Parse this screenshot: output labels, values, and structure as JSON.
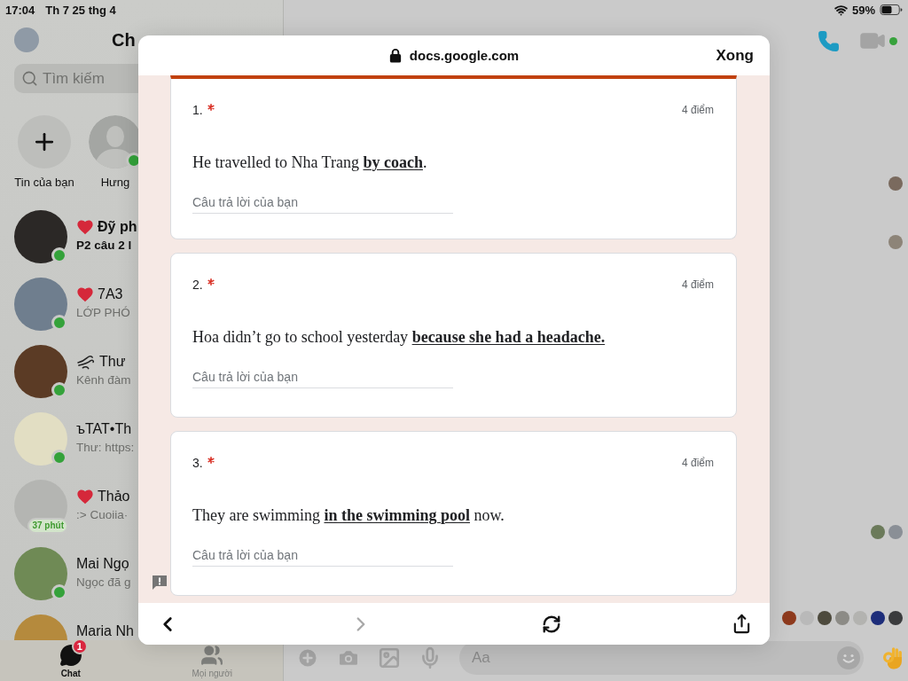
{
  "status_bar": {
    "time": "17:04",
    "date": "Th 7 25 thg 4",
    "battery": "59%"
  },
  "sidebar": {
    "title": "Ch",
    "search": {
      "placeholder": "Tìm kiếm"
    },
    "stories": [
      {
        "kind": "add",
        "label": "Tin của bạn"
      },
      {
        "kind": "person",
        "label": "Hưng",
        "online": true
      }
    ],
    "chats": [
      {
        "kind": "heart",
        "name": "Đỹ ph",
        "preview": "P2 câu 2 l",
        "unread": true,
        "online": true
      },
      {
        "kind": "heart",
        "name": "7A3",
        "preview": "LỚP PHÓ",
        "unread": false,
        "online": true
      },
      {
        "kind": "swirl",
        "name": "Thư",
        "preview": "Kênh đàm",
        "unread": false,
        "online": true
      },
      {
        "kind": "plain",
        "name": "ъTAT•Th",
        "preview": "Thư: https:",
        "unread": false,
        "online": true
      },
      {
        "kind": "heart",
        "name": "Thảo",
        "preview": ":> Cuoiia·",
        "unread": false,
        "online": false,
        "active_time": "37 phút"
      },
      {
        "kind": "plain",
        "name": "Mai Ngọ",
        "preview": "Ngọc đã g",
        "unread": false,
        "online": true
      },
      {
        "kind": "plain",
        "name": "Maria Nh",
        "unread": false,
        "online": false
      }
    ],
    "tabs": [
      {
        "kind": "chats",
        "label": "Chat",
        "selected": true,
        "badge": "1"
      },
      {
        "kind": "people",
        "label": "Mọi người",
        "selected": false
      }
    ]
  },
  "conversation": {
    "online": true,
    "composer": {
      "placeholder": "Aa"
    }
  },
  "browser_sheet": {
    "url": "docs.google.com",
    "done_button": "Xong",
    "form": {
      "questions": [
        {
          "number": "1.",
          "required": true,
          "points": "4 điểm",
          "text": "He travelled to Nha Trang **by coach**.",
          "answer_placeholder": "Câu trả lời của bạn"
        },
        {
          "number": "2.",
          "required": true,
          "points": "4 điểm",
          "text": "Hoa didn’t go to school yesterday **because she had a headache.**",
          "answer_placeholder": "Câu trả lời của bạn"
        },
        {
          "number": "3.",
          "required": true,
          "points": "4 điểm",
          "text": "They are swimming **in the swimming pool** now.",
          "answer_placeholder": "Câu trả lời của bạn"
        }
      ]
    },
    "toolbar": {
      "back": {
        "disabled": false
      },
      "forward": {
        "disabled": true
      }
    }
  }
}
